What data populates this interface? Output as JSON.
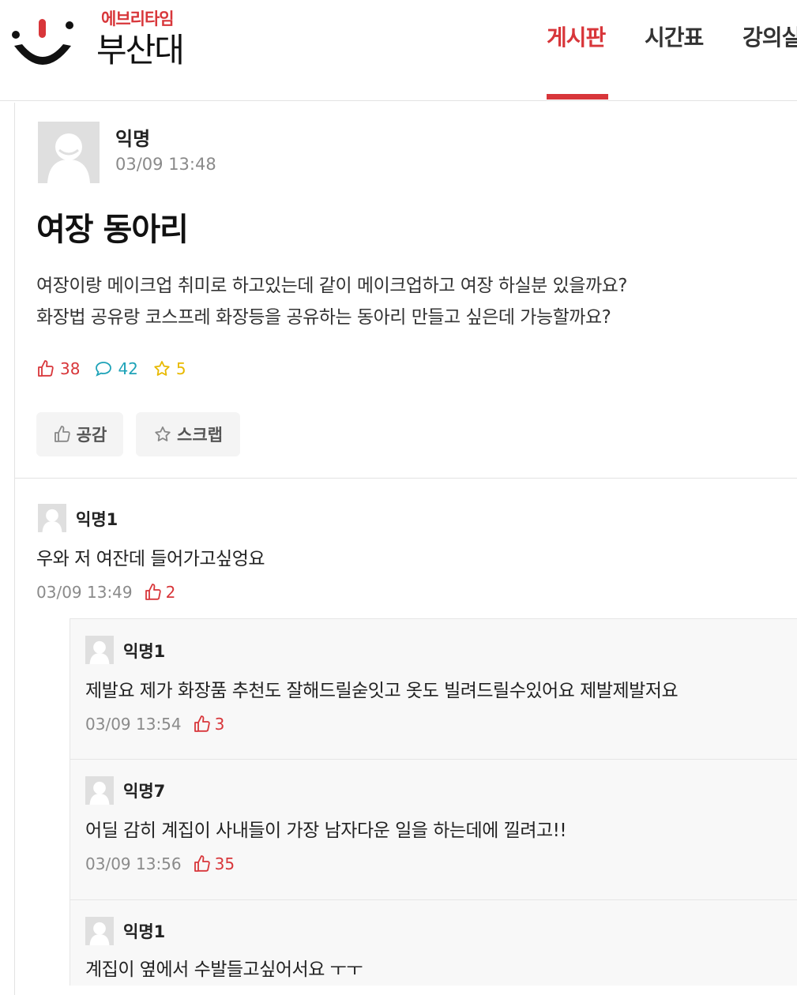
{
  "header": {
    "brand_small": "에브리타임",
    "brand_big": "부산대",
    "nav": [
      {
        "label": "게시판",
        "active": true
      },
      {
        "label": "시간표",
        "active": false
      },
      {
        "label": "강의실",
        "active": false
      }
    ],
    "accent_color": "#d8363a"
  },
  "post": {
    "author": "익명",
    "time": "03/09 13:48",
    "title": "여장 동아리",
    "body_lines": [
      "여장이랑 메이크업 취미로 하고있는데 같이 메이크업하고 여장 하실분 있을까요?",
      "화장법 공유랑 코스프레 화장등을 공유하는 동아리 만들고 싶은데 가능할까요?"
    ],
    "likes": "38",
    "comments": "42",
    "scraps": "5",
    "like_button": "공감",
    "scrap_button": "스크랩"
  },
  "comments": [
    {
      "author": "익명1",
      "text": "우와 저 여잔데 들어가고싶엉요",
      "time": "03/09 13:49",
      "likes": "2"
    },
    {
      "author": "익명1",
      "text": "제발요 제가 화장품 추천도 잘해드릴숟잇고 옷도 빌려드릴수있어요 제발제발저요",
      "time": "03/09 13:54",
      "likes": "3"
    },
    {
      "author": "익명7",
      "text": "어딜 감히 계집이 사내들이 가장 남자다운 일을 하는데에 낄려고!!",
      "time": "03/09 13:56",
      "likes": "35"
    },
    {
      "author": "익명1",
      "text": "계집이 옆에서 수발들고싶어서요 ㅜㅜ"
    }
  ]
}
